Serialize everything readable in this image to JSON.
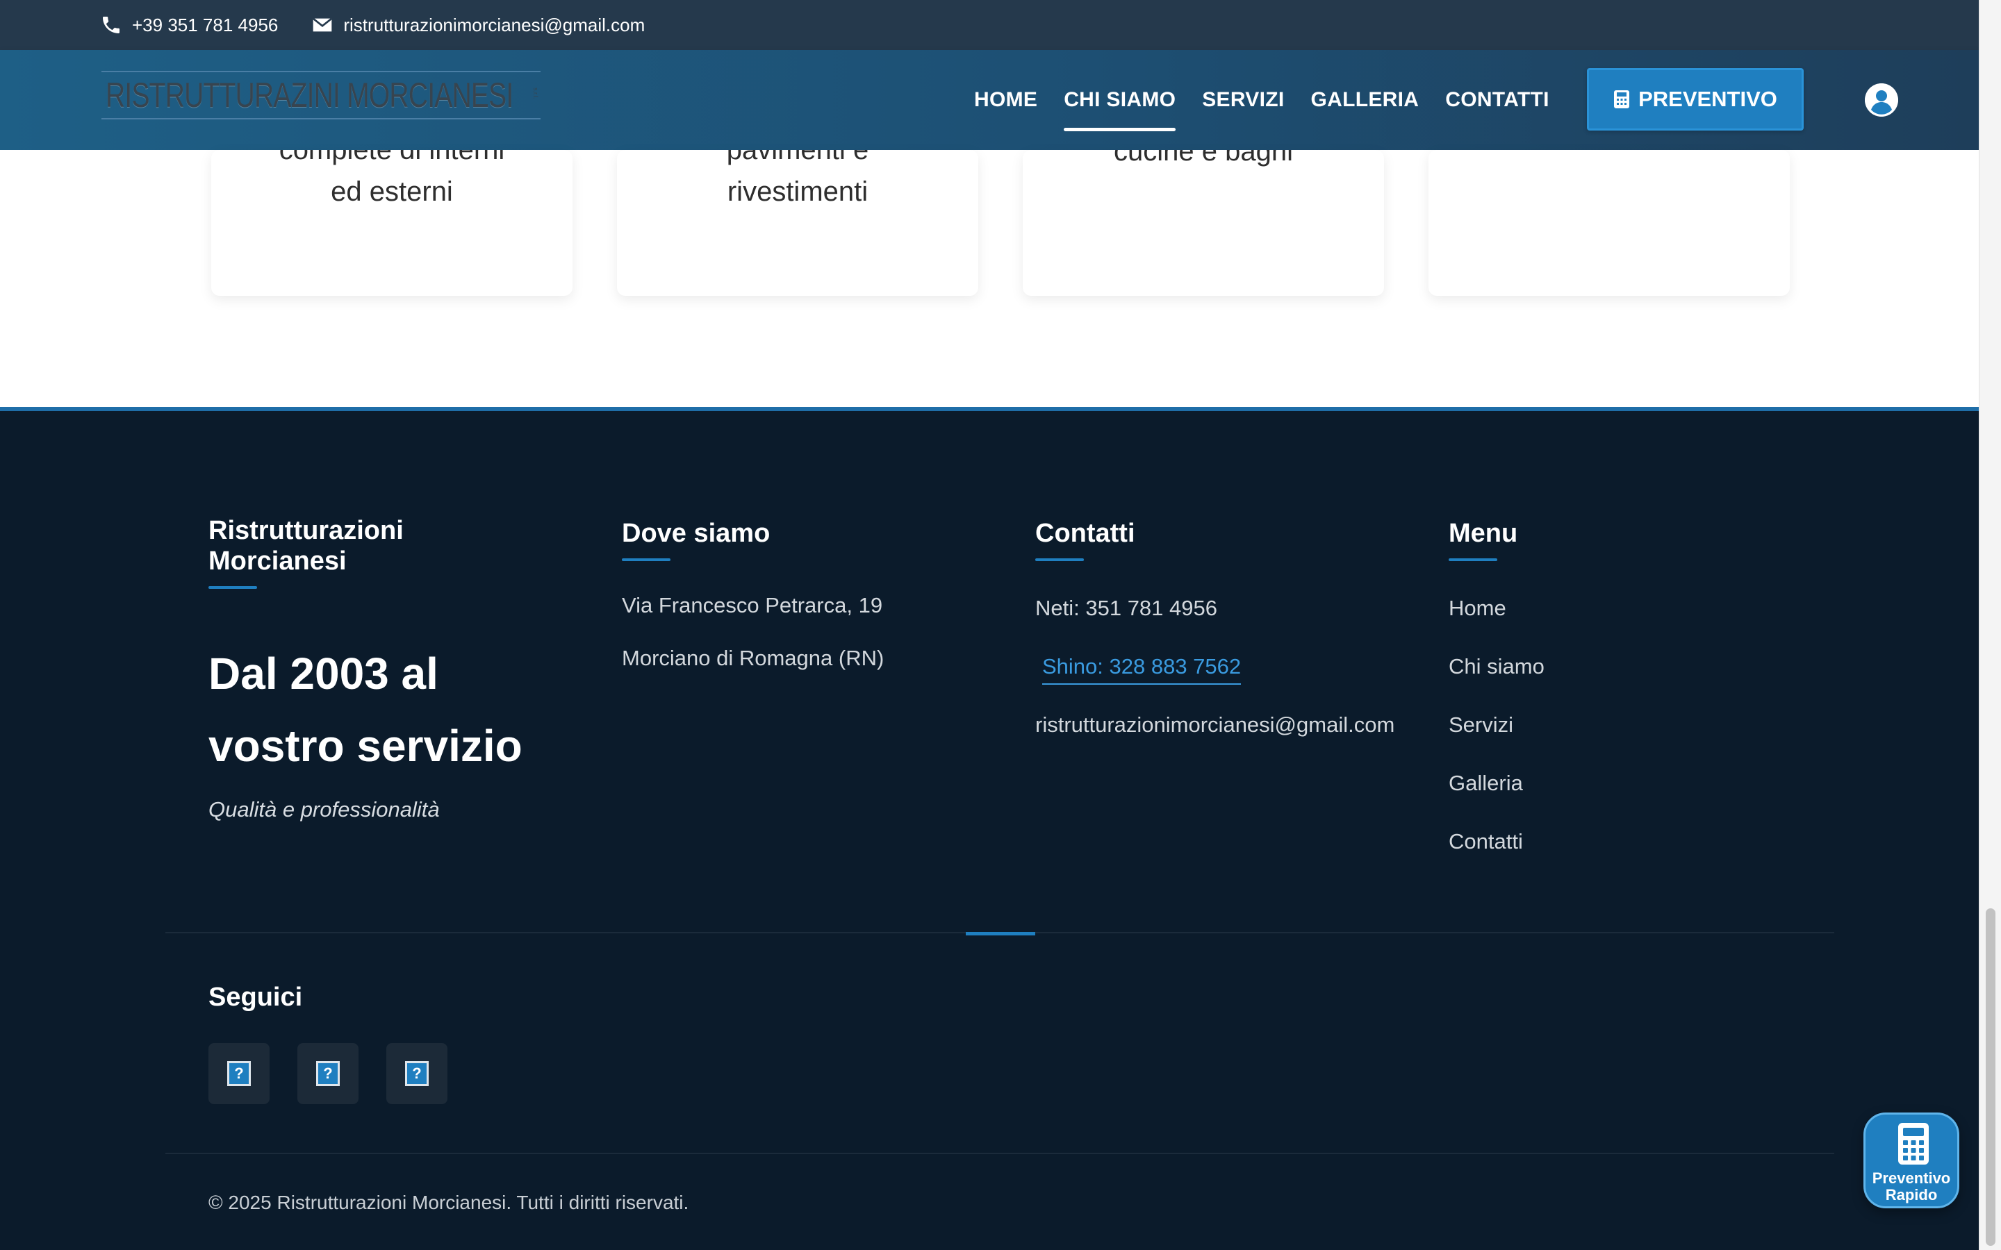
{
  "topbar": {
    "phone": "+39 351 781 4956",
    "email": "ristrutturazionimorcianesi@gmail.com"
  },
  "header": {
    "logo_text": "RISTRUTTURAZINI MORCIANESI",
    "nav": [
      "HOME",
      "CHI SIAMO",
      "SERVIZI",
      "GALLERIA",
      "CONTATTI"
    ],
    "active_nav": "CHI SIAMO",
    "cta_label": "PREVENTIVO"
  },
  "cards": [
    {
      "line1": "complete di interni",
      "line2": "ed esterni"
    },
    {
      "line1": "pavimenti e",
      "line2": "rivestimenti"
    },
    {
      "line1": "cucine e bagni",
      "line2": ""
    },
    {
      "line1": "",
      "line2": ""
    }
  ],
  "footer": {
    "company_title": "Ristrutturazioni Morcianesi",
    "company_title_line1": "Ristrutturazioni",
    "company_title_line2": "Morcianesi",
    "slogan_line1": "Dal 2003 al",
    "slogan_line2": "vostro servizio",
    "tagline": "Qualità e professionalità",
    "where_title": "Dove siamo",
    "address_line1": "Via Francesco Petrarca, 19",
    "address_line2": "Morciano di Romagna (RN)",
    "contacts_title": "Contatti",
    "contact_neti": "Neti: 351 781 4956",
    "contact_shino": "Shino: 328 883 7562",
    "contact_email": "ristrutturazionimorcianesi@gmail.com",
    "menu_title": "Menu",
    "menu_items": [
      "Home",
      "Chi siamo",
      "Servizi",
      "Galleria",
      "Contatti"
    ],
    "social_title": "Seguici",
    "social_icon_glyph": "?",
    "copyright": "© 2025 Ristrutturazioni Morcianesi. Tutti i diritti riservati."
  },
  "quick_quote": {
    "line1": "Preventivo",
    "line2": "Rapido"
  },
  "colors": {
    "topbar_bg": "#25394c",
    "header_bg": "#1e5f86",
    "accent": "#1f7fc0",
    "footer_bg": "#0b1b2b",
    "link": "#3a9be0"
  }
}
